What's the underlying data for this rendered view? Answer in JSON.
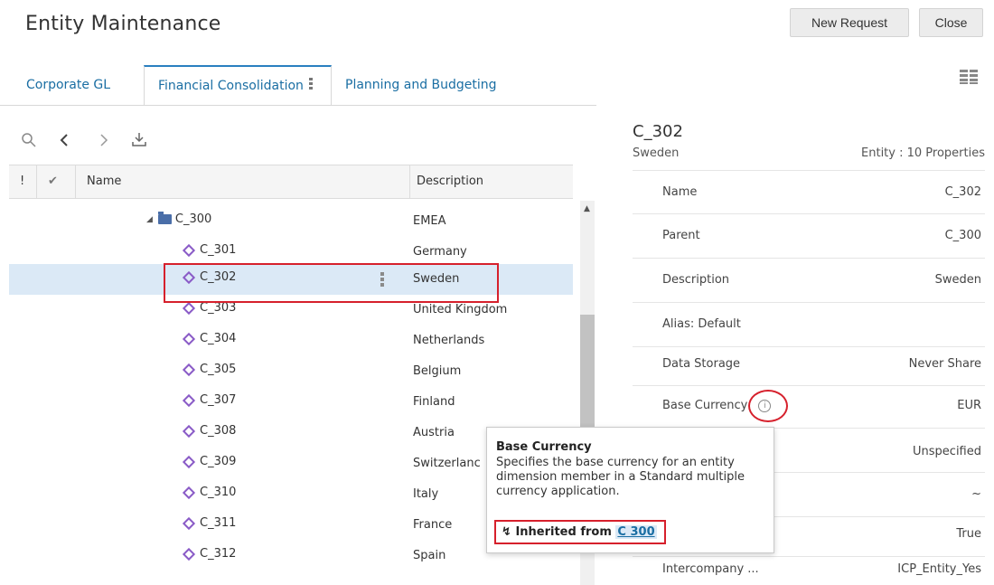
{
  "header": {
    "title": "Entity Maintenance",
    "new_request": "New Request",
    "close": "Close"
  },
  "tabs": [
    {
      "label": "Corporate GL",
      "active": false
    },
    {
      "label": "Financial Consolidation",
      "active": true
    },
    {
      "label": "Planning and Budgeting",
      "active": false
    }
  ],
  "toolbar": {
    "icons": [
      "search-icon",
      "back-icon",
      "forward-icon",
      "download-icon"
    ]
  },
  "table": {
    "columns": {
      "flag": "!",
      "check": "✔",
      "name": "Name",
      "description": "Description"
    },
    "rows": [
      {
        "name": "C_300",
        "description": "EMEA",
        "type": "folder",
        "selected": false
      },
      {
        "name": "C_301",
        "description": "Germany",
        "type": "member",
        "selected": false
      },
      {
        "name": "C_302",
        "description": "Sweden",
        "type": "member",
        "selected": true
      },
      {
        "name": "C_303",
        "description": "United Kingdom",
        "type": "member",
        "selected": false
      },
      {
        "name": "C_304",
        "description": "Netherlands",
        "type": "member",
        "selected": false
      },
      {
        "name": "C_305",
        "description": "Belgium",
        "type": "member",
        "selected": false
      },
      {
        "name": "C_307",
        "description": "Finland",
        "type": "member",
        "selected": false
      },
      {
        "name": "C_308",
        "description": "Austria",
        "type": "member",
        "selected": false
      },
      {
        "name": "C_309",
        "description": "Switzerlanc",
        "type": "member",
        "selected": false
      },
      {
        "name": "C_310",
        "description": "Italy",
        "type": "member",
        "selected": false
      },
      {
        "name": "C_311",
        "description": "France",
        "type": "member",
        "selected": false
      },
      {
        "name": "C_312",
        "description": "Spain",
        "type": "member",
        "selected": false
      }
    ]
  },
  "detail": {
    "title": "C_302",
    "subtitle": "Sweden",
    "count": "Entity : 10 Properties",
    "properties": [
      {
        "label": "Name",
        "value": "C_302"
      },
      {
        "label": "Parent",
        "value": "C_300"
      },
      {
        "label": "Description",
        "value": "Sweden"
      },
      {
        "label": "Alias: Default",
        "value": ""
      },
      {
        "label": "Data Storage",
        "value": "Never Share"
      },
      {
        "label": "Base Currency",
        "value": "EUR"
      },
      {
        "label": "",
        "value": "Unspecified"
      },
      {
        "label": "",
        "value": "~"
      },
      {
        "label": "",
        "value": "True"
      },
      {
        "label": "Intercompany ...",
        "value": "ICP_Entity_Yes"
      }
    ]
  },
  "tooltip": {
    "title": "Base Currency",
    "body": "Specifies the base currency for an entity dimension member in a Standard multiple currency application.",
    "inherited_prefix": "Inherited from",
    "inherited_link": "C 300"
  }
}
